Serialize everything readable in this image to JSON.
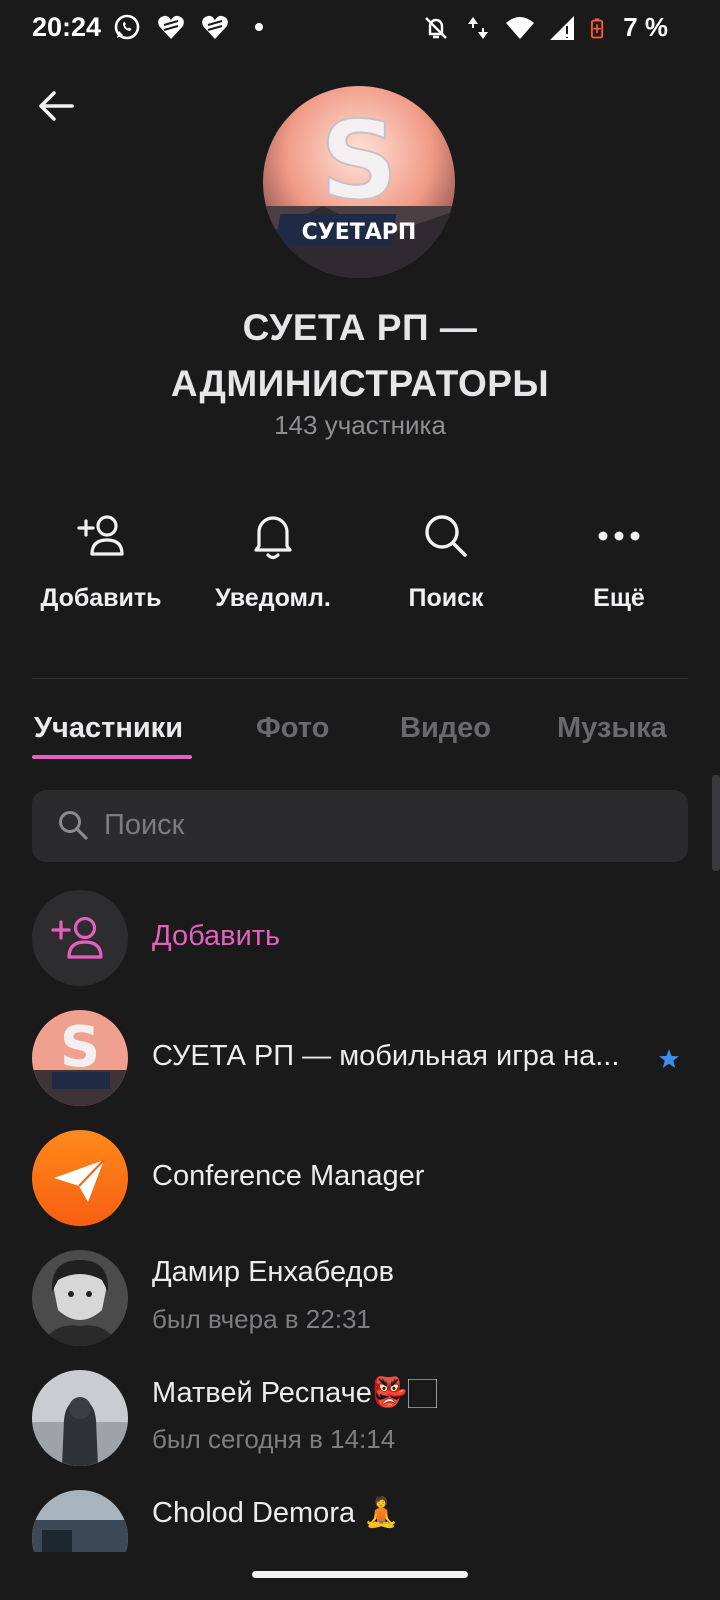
{
  "status_bar": {
    "time": "20:24",
    "battery": "7 %",
    "icons": [
      "whatsapp-icon",
      "heart-icon",
      "heart-icon",
      "dot-icon",
      "bell-off-icon",
      "data-arrows-icon",
      "wifi-icon",
      "signal-icon",
      "battery-icon"
    ]
  },
  "header": {
    "title": "СУЕТА РП — АДМИНИСТРАТОРЫ",
    "member_count": "143 участника",
    "avatar_text": "СУЕТАРП"
  },
  "actions": [
    {
      "label": "Добавить",
      "icon": "add-user-icon"
    },
    {
      "label": "Уведомл.",
      "icon": "bell-icon"
    },
    {
      "label": "Поиск",
      "icon": "search-icon"
    },
    {
      "label": "Ещё",
      "icon": "more-icon"
    }
  ],
  "tabs": [
    {
      "label": "Участники",
      "active": true
    },
    {
      "label": "Фото",
      "active": false
    },
    {
      "label": "Видео",
      "active": false
    },
    {
      "label": "Музыка",
      "active": false
    }
  ],
  "search": {
    "placeholder": "Поиск"
  },
  "add_member": {
    "label": "Добавить"
  },
  "members": [
    {
      "name": "СУЕТА РП — мобильная игра на...",
      "status": "",
      "verified": true
    },
    {
      "name": "Conference Manager",
      "status": ""
    },
    {
      "name": "Дамир Енхабедов",
      "status": "был вчера в 22:31"
    },
    {
      "name": "Матвей Респаче",
      "emoji": "👺🏻",
      "status": "был сегодня в 14:14"
    },
    {
      "name": "Cholod Demora",
      "emoji": "🧘",
      "status": ""
    }
  ],
  "colors": {
    "background": "#1a1a1b",
    "accent": "#e55fbf",
    "verified": "#3d8cf0",
    "conference_manager": "#fb6a13"
  }
}
